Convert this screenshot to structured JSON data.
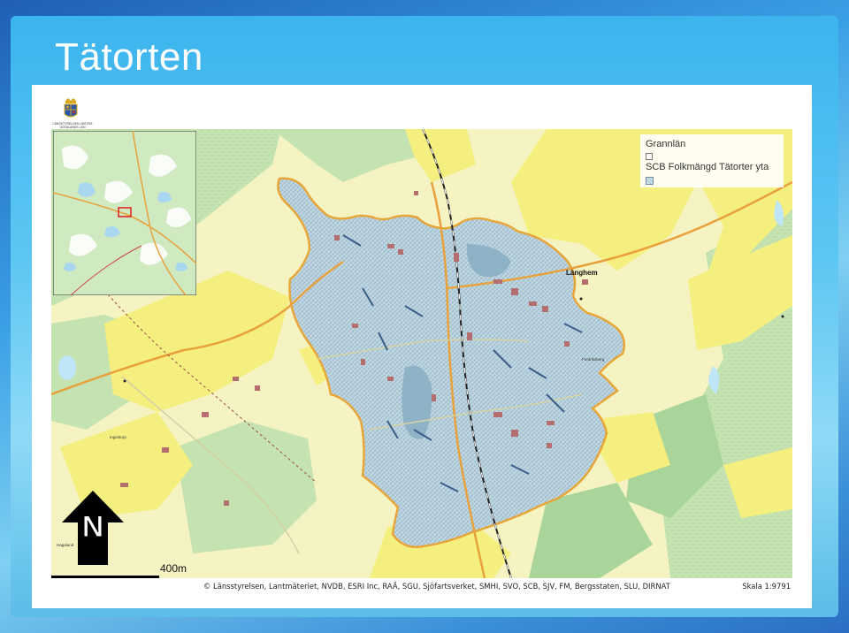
{
  "slide": {
    "title": "Tätorten"
  },
  "logo": {
    "text": "LÄNSSTYRELSEN VÄSTRA GÖTALANDS LÄN"
  },
  "legend": {
    "title": "Grannlän",
    "subtitle": "SCB Folkmängd Tätorter yta"
  },
  "map_labels": {
    "langhem": "Länghem",
    "ingestorp": "Ingestorp",
    "hagalund": "Hagalund",
    "fredriksberg": "Fredriksberg"
  },
  "north_arrow": {
    "letter": "N"
  },
  "scale": {
    "bar_label": "400m",
    "ratio_text": "Skala 1:9791"
  },
  "attribution": "© Länsstyrelsen, Lantmäteriet, NVDB, ESRI Inc, RAÄ, SGU, Sjöfartsverket, SMHI, SVO, SCB, SJV, FM, Bergsstaten, SLU, DIRNAT",
  "colors": {
    "urban_area": "#b4cfdc",
    "urban_border": "#e7a63a",
    "field_yellow": "#f4ef7e",
    "meadow_light": "#f8f7c9",
    "forest_green": "#c5e3b1",
    "forest_dark": "#a9d59a",
    "water": "#bfe6f6",
    "road_orange": "#e8a13c",
    "railway": "#222222",
    "building": "#b56e6e"
  },
  "icons": {
    "north_arrow": "north-arrow-icon",
    "logo": "crown-coat-of-arms-icon"
  }
}
